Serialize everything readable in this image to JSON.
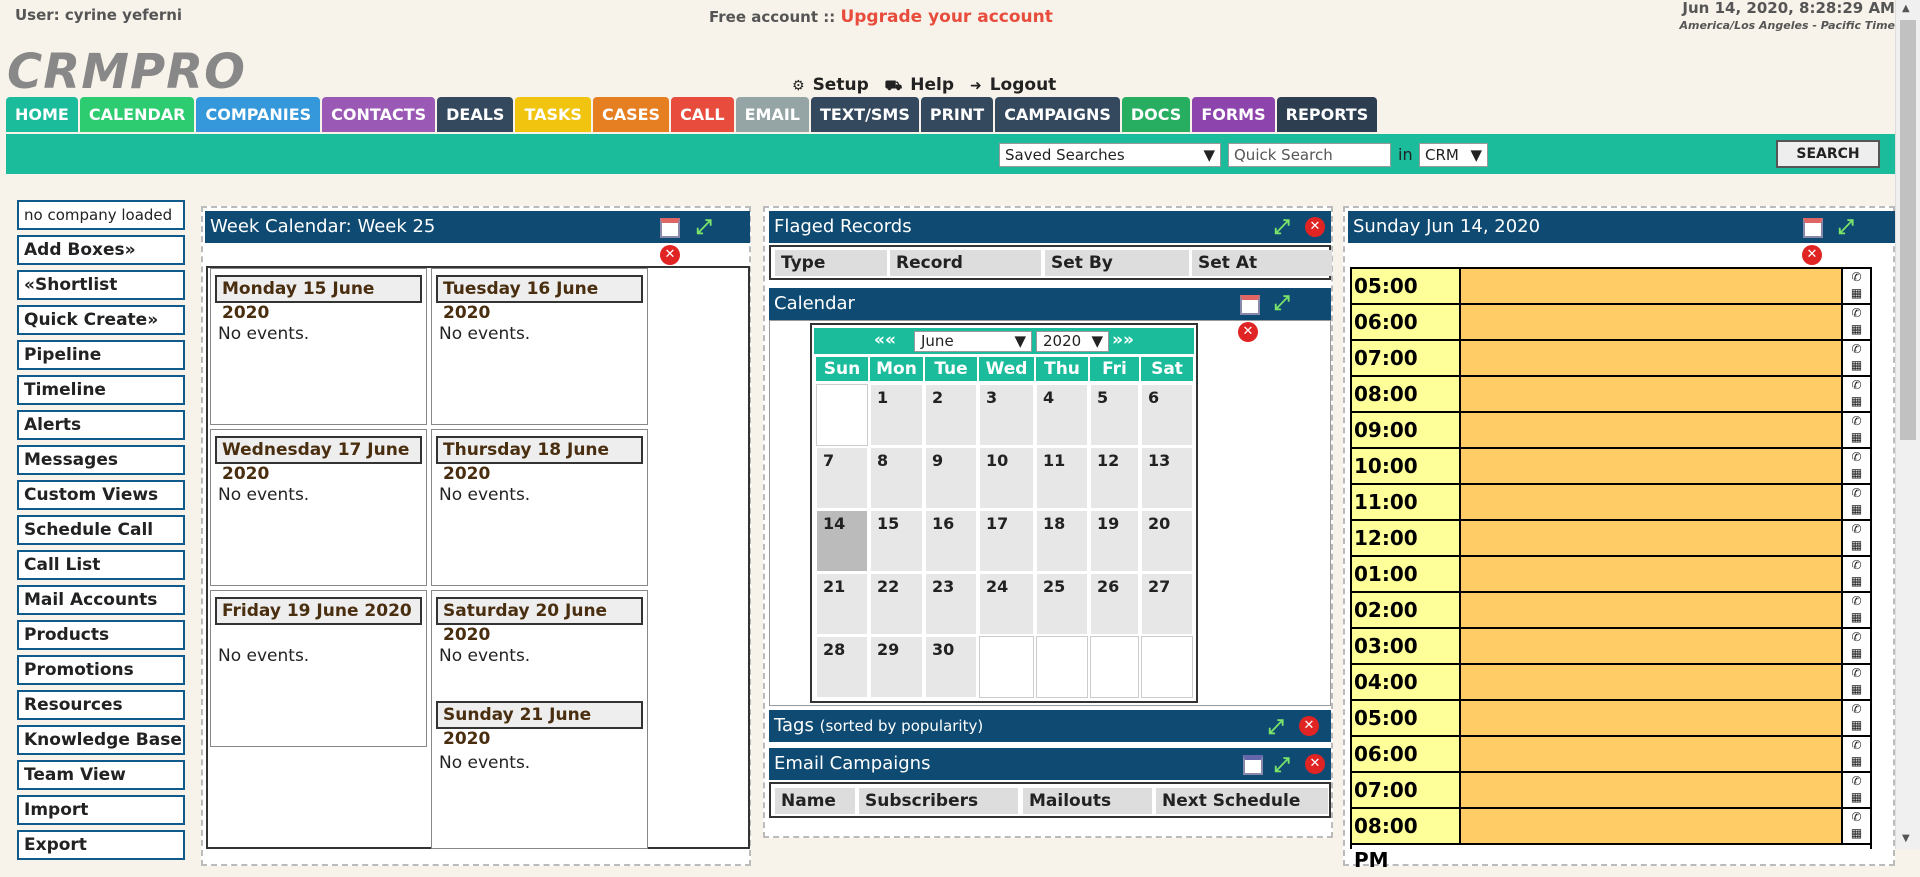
{
  "header": {
    "user": "User: cyrine yeferni",
    "free": "Free account ::",
    "upgrade": "Upgrade your account",
    "datetime": "Jun 14, 2020, 8:28:29 AM",
    "timezone": "America/Los Angeles - Pacific Time",
    "logo": "CRMPRO",
    "setup": "Setup",
    "help": "Help",
    "logout": "Logout"
  },
  "nav": [
    {
      "label": "HOME",
      "color": "#1abc9c"
    },
    {
      "label": "CALENDAR",
      "color": "#2ecc71"
    },
    {
      "label": "COMPANIES",
      "color": "#3498db"
    },
    {
      "label": "CONTACTS",
      "color": "#9b59b6"
    },
    {
      "label": "DEALS",
      "color": "#34495e"
    },
    {
      "label": "TASKS",
      "color": "#f1c40f"
    },
    {
      "label": "CASES",
      "color": "#e67e22"
    },
    {
      "label": "CALL",
      "color": "#e74c3c"
    },
    {
      "label": "EMAIL",
      "color": "#95a5a6"
    },
    {
      "label": "TEXT/SMS",
      "color": "#34495e"
    },
    {
      "label": "PRINT",
      "color": "#34495e"
    },
    {
      "label": "CAMPAIGNS",
      "color": "#34495e"
    },
    {
      "label": "DOCS",
      "color": "#27ae60"
    },
    {
      "label": "FORMS",
      "color": "#8e44ad"
    },
    {
      "label": "REPORTS",
      "color": "#2c3e50"
    }
  ],
  "search": {
    "saved": "Saved Searches",
    "quick": "Quick Search",
    "in": "in",
    "scope": "CRM",
    "button": "SEARCH"
  },
  "left": [
    "no company loaded",
    "Add Boxes»",
    "«Shortlist",
    "Quick Create»",
    "Pipeline",
    "Timeline",
    "Alerts",
    "Messages",
    "Custom Views",
    "Schedule Call",
    "Call List",
    "Mail Accounts",
    "Products",
    "Promotions",
    "Resources",
    "Knowledge Base",
    "Team View",
    "Import",
    "Export"
  ],
  "week": {
    "title": "Week Calendar: Week 25",
    "days": [
      "Monday 15 June 2020",
      "Tuesday 16 June 2020",
      "Wednesday 17 June 2020",
      "Thursday 18 June 2020",
      "Friday 19 June 2020",
      "Saturday 20 June 2020",
      "Sunday 21 June 2020"
    ],
    "noevents": "No events."
  },
  "flagged": {
    "title": "Flaged Records",
    "cols": [
      "Type",
      "Record",
      "Set By",
      "Set At"
    ]
  },
  "calendar": {
    "title": "Calendar",
    "month": "June",
    "year": "2020",
    "prev": "««",
    "next": "»»",
    "dow": [
      "Sun",
      "Mon",
      "Tue",
      "Wed",
      "Thu",
      "Fri",
      "Sat"
    ],
    "weeks": [
      [
        "",
        "1",
        "2",
        "3",
        "4",
        "5",
        "6"
      ],
      [
        "7",
        "8",
        "9",
        "10",
        "11",
        "12",
        "13"
      ],
      [
        "14",
        "15",
        "16",
        "17",
        "18",
        "19",
        "20"
      ],
      [
        "21",
        "22",
        "23",
        "24",
        "25",
        "26",
        "27"
      ],
      [
        "28",
        "29",
        "30",
        "",
        "",
        "",
        ""
      ]
    ],
    "today": "14"
  },
  "tags": {
    "title": "Tags",
    "sub": "(sorted by popularity)"
  },
  "email": {
    "title": "Email Campaigns",
    "cols": [
      "Name",
      "Subscribers",
      "Mailouts",
      "Next Schedule"
    ]
  },
  "day": {
    "title": "Sunday Jun 14, 2020",
    "slots": [
      "05:00 AM",
      "06:00 AM",
      "07:00 AM",
      "08:00 AM",
      "09:00 AM",
      "10:00 AM",
      "11:00 AM",
      "12:00 PM",
      "01:00 PM",
      "02:00 PM",
      "03:00 PM",
      "04:00 PM",
      "05:00 PM",
      "06:00 PM",
      "07:00 PM",
      "08:00 PM"
    ]
  }
}
